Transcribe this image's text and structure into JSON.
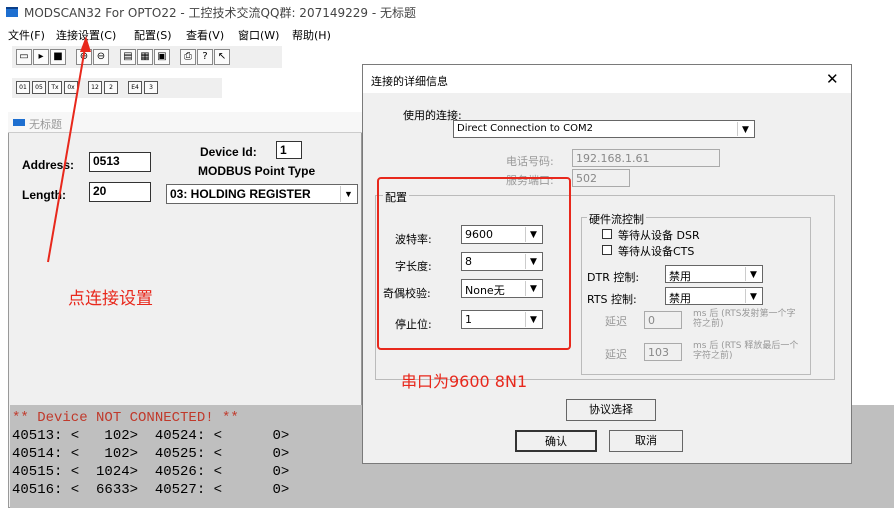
{
  "window": {
    "title": "MODSCAN32 For OPTO22 - 工控技术交流QQ群: 207149229 - 无标题"
  },
  "menu": [
    "文件(F)",
    "连接设置(C)",
    "配置(S)",
    "查看(V)",
    "窗口(W)",
    "帮助(H)"
  ],
  "toolbar1": [
    "new",
    "open",
    "save",
    "connect",
    "disconnect",
    "config1",
    "config2",
    "config3",
    "print",
    "about",
    "help"
  ],
  "toolbar2": [
    "01",
    "05",
    "Tx",
    "0x",
    "12",
    "2",
    "E4",
    "3"
  ],
  "child": {
    "title": "无标题",
    "device_id_label": "Device Id:",
    "device_id": "1",
    "address_label": "Address:",
    "address": "0513",
    "point_type_label": "MODBUS Point Type",
    "length_label": "Length:",
    "length": "20",
    "point_type": "03: HOLDING REGISTER"
  },
  "annotation_left": "点连接设置",
  "annotation_right": "串口为9600 8N1",
  "console": {
    "status": "** Device NOT CONNECTED! **",
    "lines": [
      "40513: <   102>  40524: <      0>",
      "40514: <   102>  40525: <      0>",
      "40515: <  1024>  40526: <      0>",
      "40516: <  6633>  40527: <      0>"
    ]
  },
  "dialog": {
    "title": "连接的详细信息",
    "close": "✕",
    "connection_label": "使用的连接:",
    "connection": "Direct Connection to COM2",
    "phone_label": "电话号码:",
    "phone": "192.168.1.61",
    "port_label": "服务端口:",
    "port": "502",
    "config_label": "配置",
    "baud_label": "波特率:",
    "baud": "9600",
    "databits_label": "字长度:",
    "databits": "8",
    "parity_label": "奇偶校验:",
    "parity": "None无",
    "stopbits_label": "停止位:",
    "stopbits": "1",
    "hw_label": "硬件流控制",
    "dsr_label": "等待从设备 DSR",
    "cts_label": "等待从设备CTS",
    "dtr_label": "DTR 控制:",
    "dtr": "禁用",
    "rts_label": "RTS 控制:",
    "rts": "禁用",
    "delay1_label": "延迟",
    "delay1": "0",
    "delay1_note": "ms 后 (RTS发射第一个字符之前)",
    "delay2_label": "延迟",
    "delay2": "103",
    "delay2_note": "ms 后 (RTS 释放最后一个字符之前)",
    "protocol_btn": "协议选择",
    "ok_btn": "确认",
    "cancel_btn": "取消"
  },
  "colors": {
    "annotation": "#e8281c",
    "console_bg": "#bfbfbf",
    "status_text": "#c0392b"
  }
}
